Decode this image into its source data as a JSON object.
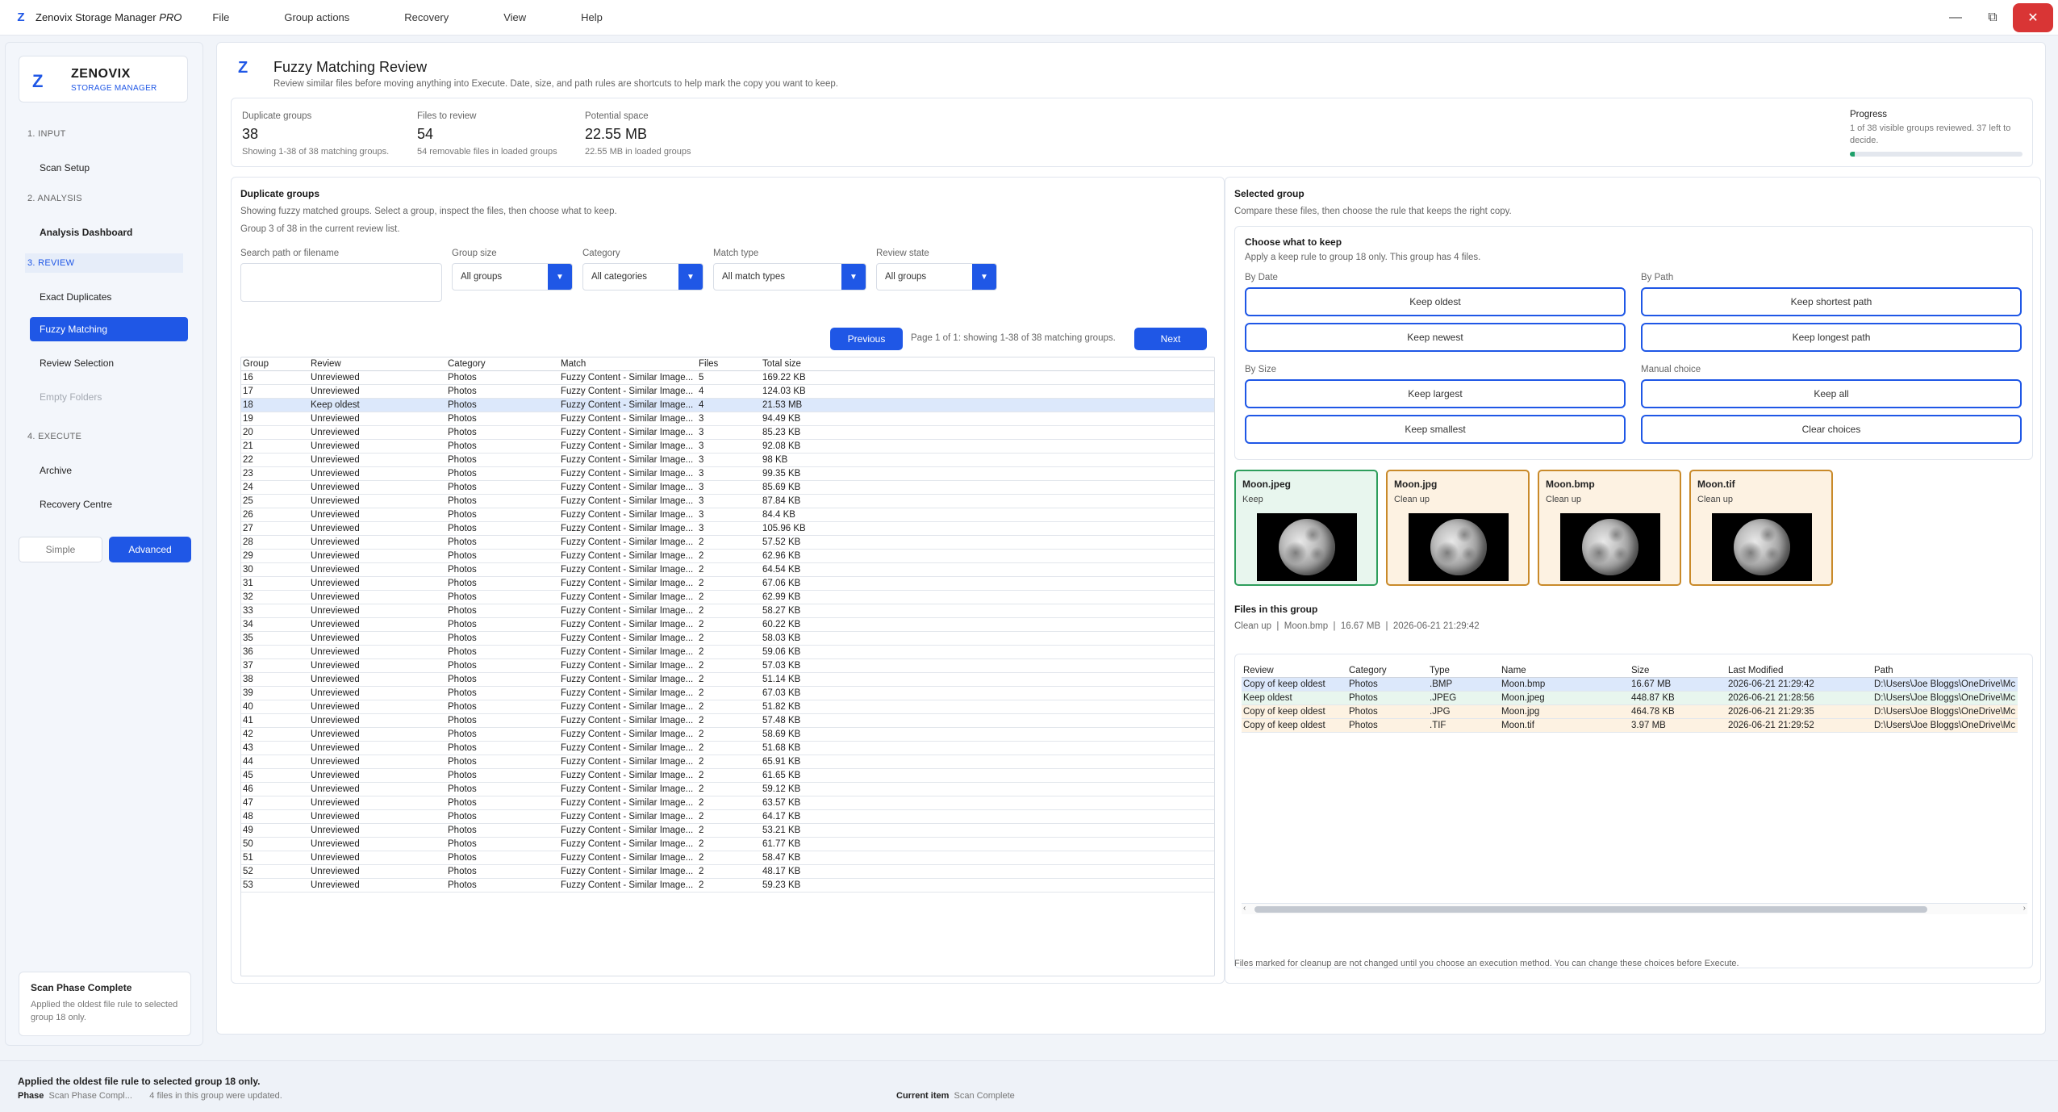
{
  "app": {
    "title": "Zenovix Storage Manager",
    "edition": "PRO",
    "logo": "Z"
  },
  "menu": [
    "File",
    "Group actions",
    "Recovery",
    "View",
    "Help"
  ],
  "sidebar": {
    "brand_name": "ZENOVIX",
    "brand_sub": "STORAGE MANAGER",
    "sections": [
      "1. INPUT",
      "2. ANALYSIS",
      "3. REVIEW",
      "4. EXECUTE"
    ],
    "items": {
      "scan_setup": "Scan Setup",
      "analysis_dashboard": "Analysis Dashboard",
      "exact_duplicates": "Exact Duplicates",
      "fuzzy_matching": "Fuzzy Matching",
      "review_selection": "Review Selection",
      "empty_folders": "Empty Folders",
      "archive": "Archive",
      "recovery_centre": "Recovery Centre"
    },
    "modes": {
      "simple": "Simple",
      "advanced": "Advanced"
    },
    "phase": {
      "title": "Scan Phase Complete",
      "desc": "Applied the oldest file rule to selected group 18 only."
    }
  },
  "page": {
    "title": "Fuzzy Matching Review",
    "subtitle": "Review similar files before moving anything into Execute. Date, size, and path rules are shortcuts to help mark the copy you want to keep."
  },
  "stats": {
    "dup_label": "Duplicate groups",
    "dup_value": "38",
    "dup_sub": "Showing 1-38 of 38 matching groups.",
    "files_label": "Files to review",
    "files_value": "54",
    "files_sub": "54 removable files in loaded groups",
    "space_label": "Potential space",
    "space_value": "22.55 MB",
    "space_sub": "22.55 MB in loaded groups",
    "progress_label": "Progress",
    "progress_sub": "1 of 38 visible groups reviewed. 37 left to decide.",
    "progress_fraction": 0.026
  },
  "groups_panel": {
    "title": "Duplicate groups",
    "desc1": "Showing fuzzy matched groups. Select a group, inspect the files, then choose what to keep.",
    "desc2": "Group 3 of 38 in the current review list.",
    "search_label": "Search path or filename",
    "search_value": "",
    "filters": {
      "group_size_label": "Group size",
      "group_size_value": "All groups",
      "category_label": "Category",
      "category_value": "All categories",
      "match_type_label": "Match type",
      "match_type_value": "All match types",
      "review_state_label": "Review state",
      "review_state_value": "All groups"
    },
    "prev": "Previous",
    "next": "Next",
    "page_info": "Page 1 of 1: showing 1-38 of 38 matching groups.",
    "columns": [
      "Group",
      "Review",
      "Category",
      "Match",
      "Files",
      "Total size"
    ],
    "selected_index": 2,
    "rows": [
      [
        "16",
        "Unreviewed",
        "Photos",
        "Fuzzy Content - Similar Image...",
        "5",
        "169.22 KB"
      ],
      [
        "17",
        "Unreviewed",
        "Photos",
        "Fuzzy Content - Similar Image...",
        "4",
        "124.03 KB"
      ],
      [
        "18",
        "Keep oldest",
        "Photos",
        "Fuzzy Content - Similar Image...",
        "4",
        "21.53 MB"
      ],
      [
        "19",
        "Unreviewed",
        "Photos",
        "Fuzzy Content - Similar Image...",
        "3",
        "94.49 KB"
      ],
      [
        "20",
        "Unreviewed",
        "Photos",
        "Fuzzy Content - Similar Image...",
        "3",
        "85.23 KB"
      ],
      [
        "21",
        "Unreviewed",
        "Photos",
        "Fuzzy Content - Similar Image...",
        "3",
        "92.08 KB"
      ],
      [
        "22",
        "Unreviewed",
        "Photos",
        "Fuzzy Content - Similar Image...",
        "3",
        "98 KB"
      ],
      [
        "23",
        "Unreviewed",
        "Photos",
        "Fuzzy Content - Similar Image...",
        "3",
        "99.35 KB"
      ],
      [
        "24",
        "Unreviewed",
        "Photos",
        "Fuzzy Content - Similar Image...",
        "3",
        "85.69 KB"
      ],
      [
        "25",
        "Unreviewed",
        "Photos",
        "Fuzzy Content - Similar Image...",
        "3",
        "87.84 KB"
      ],
      [
        "26",
        "Unreviewed",
        "Photos",
        "Fuzzy Content - Similar Image...",
        "3",
        "84.4 KB"
      ],
      [
        "27",
        "Unreviewed",
        "Photos",
        "Fuzzy Content - Similar Image...",
        "3",
        "105.96 KB"
      ],
      [
        "28",
        "Unreviewed",
        "Photos",
        "Fuzzy Content - Similar Image...",
        "2",
        "57.52 KB"
      ],
      [
        "29",
        "Unreviewed",
        "Photos",
        "Fuzzy Content - Similar Image...",
        "2",
        "62.96 KB"
      ],
      [
        "30",
        "Unreviewed",
        "Photos",
        "Fuzzy Content - Similar Image...",
        "2",
        "64.54 KB"
      ],
      [
        "31",
        "Unreviewed",
        "Photos",
        "Fuzzy Content - Similar Image...",
        "2",
        "67.06 KB"
      ],
      [
        "32",
        "Unreviewed",
        "Photos",
        "Fuzzy Content - Similar Image...",
        "2",
        "62.99 KB"
      ],
      [
        "33",
        "Unreviewed",
        "Photos",
        "Fuzzy Content - Similar Image...",
        "2",
        "58.27 KB"
      ],
      [
        "34",
        "Unreviewed",
        "Photos",
        "Fuzzy Content - Similar Image...",
        "2",
        "60.22 KB"
      ],
      [
        "35",
        "Unreviewed",
        "Photos",
        "Fuzzy Content - Similar Image...",
        "2",
        "58.03 KB"
      ],
      [
        "36",
        "Unreviewed",
        "Photos",
        "Fuzzy Content - Similar Image...",
        "2",
        "59.06 KB"
      ],
      [
        "37",
        "Unreviewed",
        "Photos",
        "Fuzzy Content - Similar Image...",
        "2",
        "57.03 KB"
      ],
      [
        "38",
        "Unreviewed",
        "Photos",
        "Fuzzy Content - Similar Image...",
        "2",
        "51.14 KB"
      ],
      [
        "39",
        "Unreviewed",
        "Photos",
        "Fuzzy Content - Similar Image...",
        "2",
        "67.03 KB"
      ],
      [
        "40",
        "Unreviewed",
        "Photos",
        "Fuzzy Content - Similar Image...",
        "2",
        "51.82 KB"
      ],
      [
        "41",
        "Unreviewed",
        "Photos",
        "Fuzzy Content - Similar Image...",
        "2",
        "57.48 KB"
      ],
      [
        "42",
        "Unreviewed",
        "Photos",
        "Fuzzy Content - Similar Image...",
        "2",
        "58.69 KB"
      ],
      [
        "43",
        "Unreviewed",
        "Photos",
        "Fuzzy Content - Similar Image...",
        "2",
        "51.68 KB"
      ],
      [
        "44",
        "Unreviewed",
        "Photos",
        "Fuzzy Content - Similar Image...",
        "2",
        "65.91 KB"
      ],
      [
        "45",
        "Unreviewed",
        "Photos",
        "Fuzzy Content - Similar Image...",
        "2",
        "61.65 KB"
      ],
      [
        "46",
        "Unreviewed",
        "Photos",
        "Fuzzy Content - Similar Image...",
        "2",
        "59.12 KB"
      ],
      [
        "47",
        "Unreviewed",
        "Photos",
        "Fuzzy Content - Similar Image...",
        "2",
        "63.57 KB"
      ],
      [
        "48",
        "Unreviewed",
        "Photos",
        "Fuzzy Content - Similar Image...",
        "2",
        "64.17 KB"
      ],
      [
        "49",
        "Unreviewed",
        "Photos",
        "Fuzzy Content - Similar Image...",
        "2",
        "53.21 KB"
      ],
      [
        "50",
        "Unreviewed",
        "Photos",
        "Fuzzy Content - Similar Image...",
        "2",
        "61.77 KB"
      ],
      [
        "51",
        "Unreviewed",
        "Photos",
        "Fuzzy Content - Similar Image...",
        "2",
        "58.47 KB"
      ],
      [
        "52",
        "Unreviewed",
        "Photos",
        "Fuzzy Content - Similar Image...",
        "2",
        "48.17 KB"
      ],
      [
        "53",
        "Unreviewed",
        "Photos",
        "Fuzzy Content - Similar Image...",
        "2",
        "59.23 KB"
      ]
    ]
  },
  "selected_panel": {
    "title": "Selected group",
    "desc": "Compare these files, then choose the rule that keeps the right copy.",
    "keep_title": "Choose what to keep",
    "keep_desc": "Apply a keep rule to group 18 only. This group has 4 files.",
    "by_date": "By Date",
    "by_path": "By Path",
    "by_size": "By Size",
    "manual": "Manual choice",
    "buttons": {
      "keep_oldest": "Keep oldest",
      "keep_newest": "Keep newest",
      "keep_shortest_path": "Keep shortest path",
      "keep_longest_path": "Keep longest path",
      "keep_largest": "Keep largest",
      "keep_smallest": "Keep smallest",
      "keep_all": "Keep all",
      "clear_choices": "Clear choices"
    },
    "cards": [
      {
        "name": "Moon.jpeg",
        "status": "Keep"
      },
      {
        "name": "Moon.jpg",
        "status": "Clean up"
      },
      {
        "name": "Moon.bmp",
        "status": "Clean up"
      },
      {
        "name": "Moon.tif",
        "status": "Clean up"
      }
    ],
    "files_title": "Files in this group",
    "files_info": "Clean up  |  Moon.bmp  |  16.67 MB  |  2026-06-21 21:29:42",
    "file_columns": [
      "Review",
      "Category",
      "Type",
      "Name",
      "Size",
      "Last Modified",
      "Path"
    ],
    "files": [
      [
        "Copy of keep oldest",
        "Photos",
        ".BMP",
        "Moon.bmp",
        "16.67 MB",
        "2026-06-21 21:29:42",
        "D:\\Users\\Joe Bloggs\\OneDrive\\Mc"
      ],
      [
        "Keep oldest",
        "Photos",
        ".JPEG",
        "Moon.jpeg",
        "448.87 KB",
        "2026-06-21 21:28:56",
        "D:\\Users\\Joe Bloggs\\OneDrive\\Mc"
      ],
      [
        "Copy of keep oldest",
        "Photos",
        ".JPG",
        "Moon.jpg",
        "464.78 KB",
        "2026-06-21 21:29:35",
        "D:\\Users\\Joe Bloggs\\OneDrive\\Mc"
      ],
      [
        "Copy of keep oldest",
        "Photos",
        ".TIF",
        "Moon.tif",
        "3.97 MB",
        "2026-06-21 21:29:52",
        "D:\\Users\\Joe Bloggs\\OneDrive\\Mc"
      ]
    ],
    "footer": "Files marked for cleanup are not changed until you choose an execution method. You can change these choices before Execute."
  },
  "status": {
    "message": "Applied the oldest file rule to selected group 18 only.",
    "phase_label": "Phase",
    "phase_value": "Scan Phase Compl...",
    "phase_note": "4 files in this group were updated.",
    "current_label": "Current item",
    "current_value": "Scan Complete"
  },
  "colors": {
    "accent": "#1f57e6",
    "keep": "#2e9e5c",
    "cleanup": "#c98a2a",
    "progress": "#1ea06a"
  }
}
